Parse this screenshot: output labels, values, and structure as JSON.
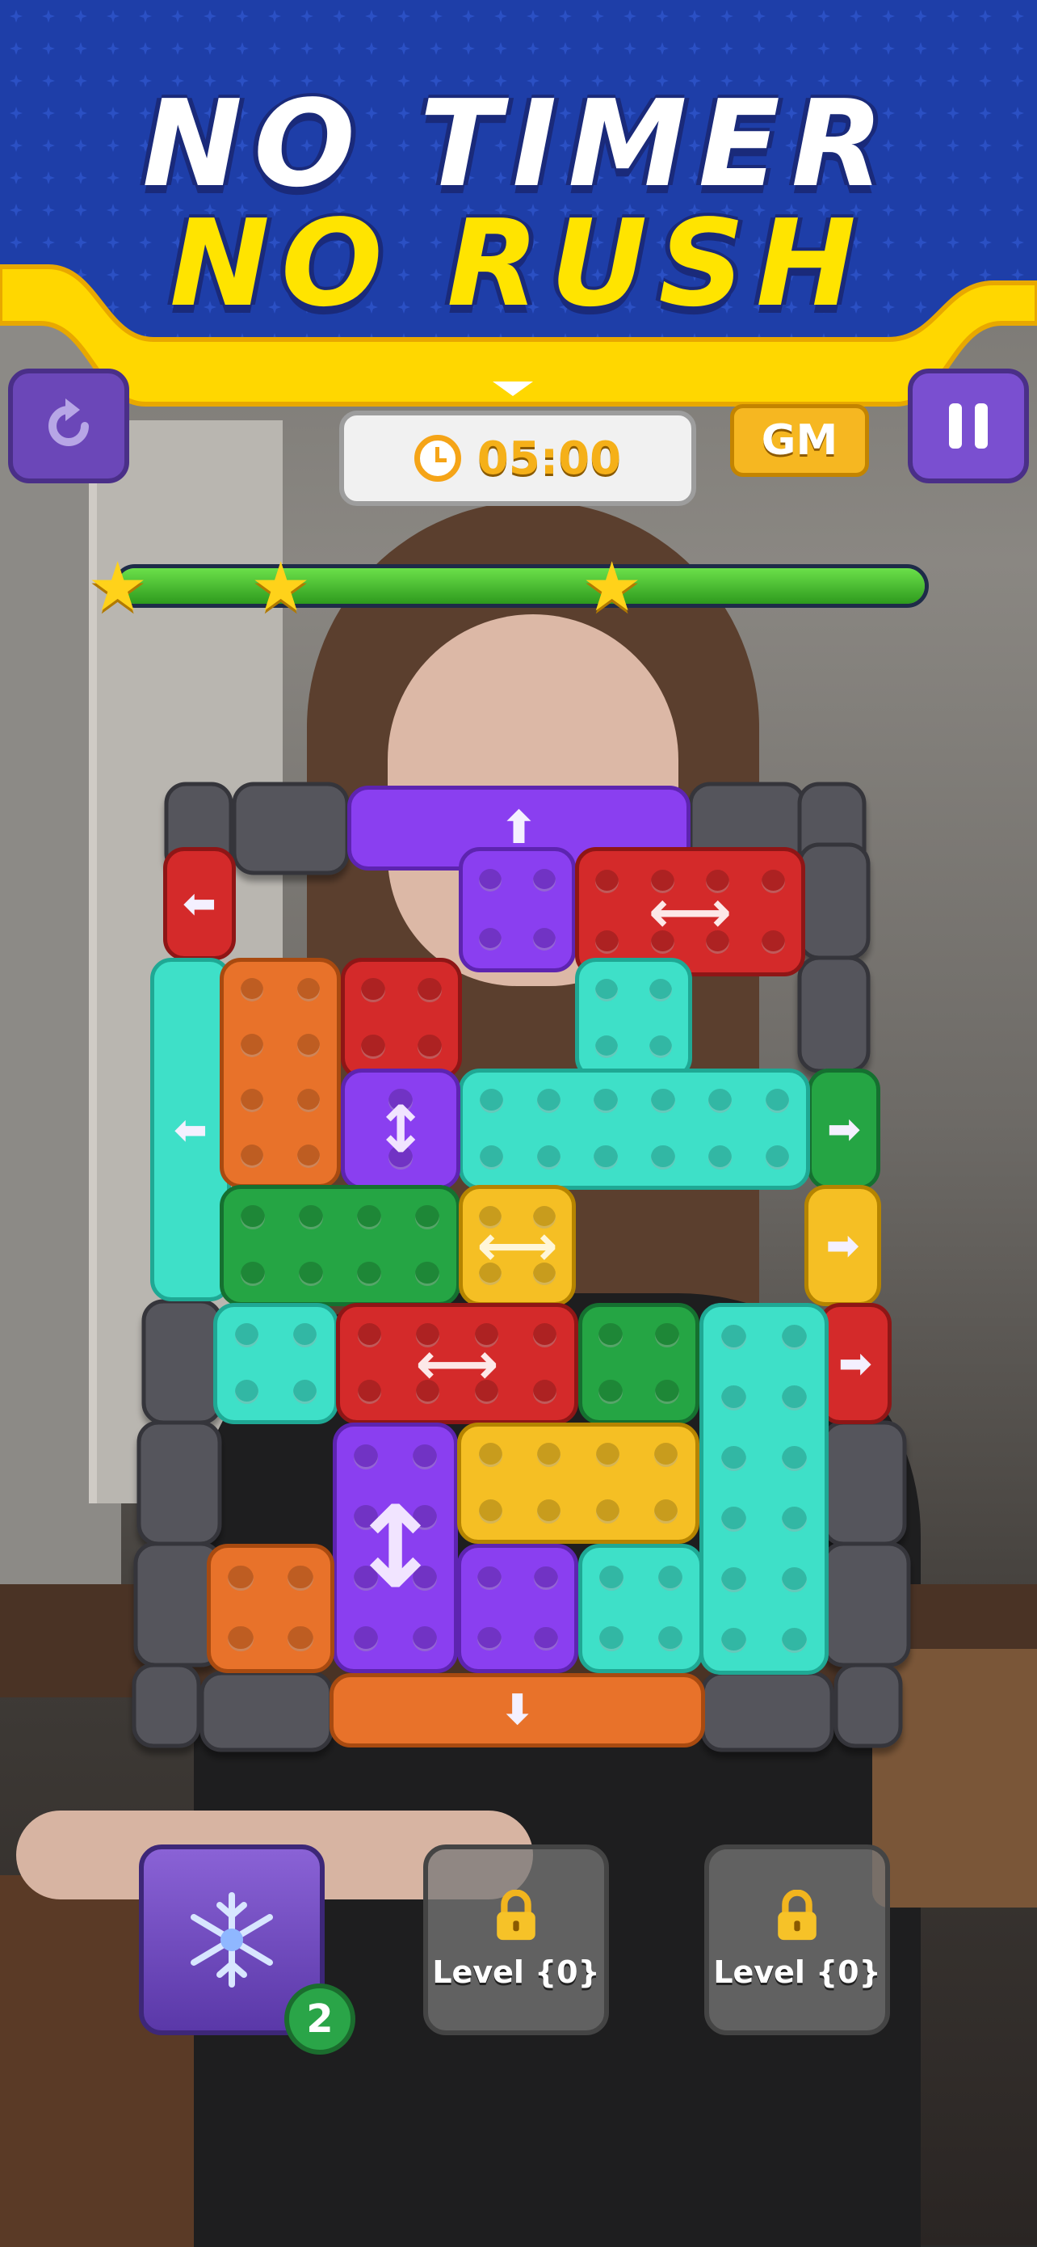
{
  "banner": {
    "line1": "NO TIMER",
    "line2": "NO RUSH"
  },
  "hud": {
    "restart_icon": "restart-icon",
    "timer_value": "05:00",
    "gm_label": "GM",
    "pause_icon": "pause-icon"
  },
  "progress": {
    "value": 1.0,
    "stars": 3
  },
  "boosters": [
    {
      "name": "freeze-icon",
      "count": "2"
    },
    {
      "label": "Level {0}",
      "locked": true
    },
    {
      "label": "Level {0}",
      "locked": true
    }
  ],
  "colors": {
    "purple": "#8a3ff0",
    "red": "#d42a2a",
    "orange": "#e8722a",
    "teal": "#3ee0c8",
    "green": "#25a544",
    "yellow": "#f5bf24",
    "wall": "#5a5a60",
    "banner_blue": "#1e3ea8",
    "banner_yellow": "#ffd700"
  }
}
